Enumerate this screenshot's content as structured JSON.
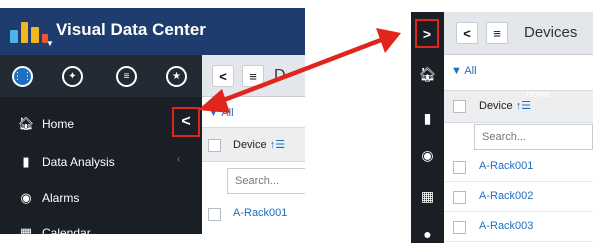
{
  "left": {
    "app_title": "Visual Data Center",
    "nav": {
      "home": "Home",
      "data_analysis": "Data Analysis",
      "alarms": "Alarms",
      "calendar": "Calendar"
    },
    "collapse_glyph": "<",
    "devices_title_partial": "D",
    "filter_label": "All",
    "column_device": "Device",
    "search_placeholder": "Search...",
    "rows": [
      "A-Rack001"
    ]
  },
  "right": {
    "expand_glyph": ">",
    "devices_title": "Devices",
    "filter_label": "All",
    "tooltip": "Home",
    "column_device": "Device",
    "search_placeholder": "Search...",
    "rows": [
      "A-Rack001",
      "A-Rack002",
      "A-Rack003"
    ]
  },
  "colors": {
    "header_blue": "#1e3c6e",
    "sidebar_dark": "#1a1e25",
    "accent_blue": "#1f6fc0",
    "highlight_red": "#e0251c"
  },
  "icons": [
    "logo-bars-icon",
    "grid-icon",
    "compass-icon",
    "list-icon",
    "star-icon",
    "home-icon",
    "chart-icon",
    "alarm-icon",
    "calendar-icon",
    "filter-icon",
    "sort-icon",
    "menu-icon",
    "back-icon",
    "chevron-icon",
    "arrow-icon"
  ]
}
